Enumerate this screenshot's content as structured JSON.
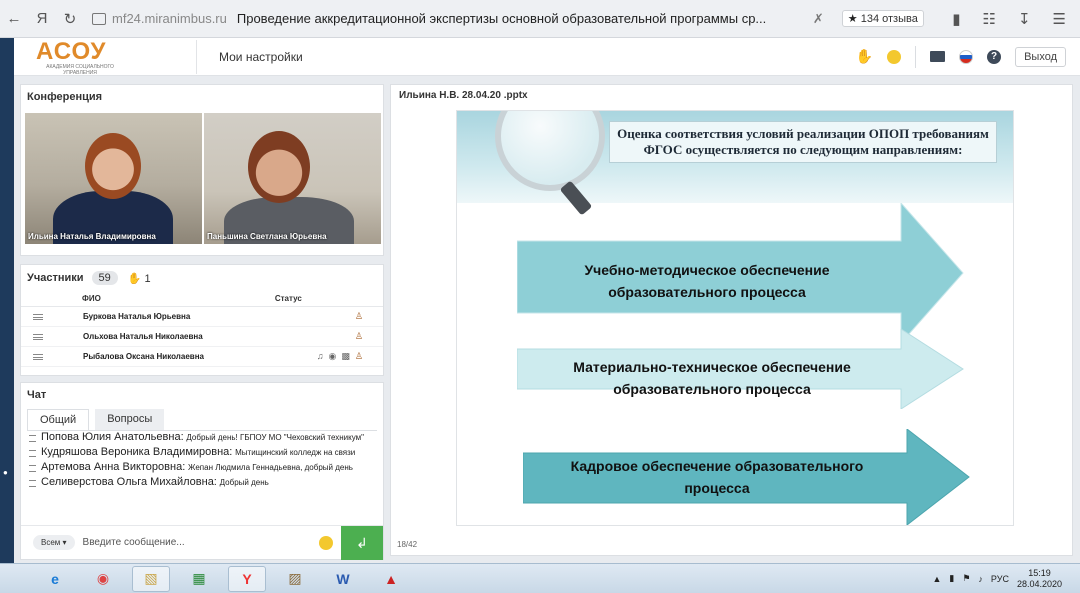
{
  "browser": {
    "url": "mf24.miranimbus.ru",
    "tab_title": "Проведение аккредитационной экспертизы основной образовательной программы ср...",
    "reviews": "134 отзыва",
    "ya_glyph": "Я"
  },
  "header": {
    "logo_text": "АСОУ",
    "logo_subtitle": "АКАДЕМИЯ СОЦИАЛЬНОГО УПРАВЛЕНИЯ",
    "settings_label": "Мои настройки",
    "logout_label": "Выход"
  },
  "conference": {
    "title": "Конференция",
    "videos": [
      {
        "name": "Ильина Наталья Владимировна"
      },
      {
        "name": "Паньшина Светлана Юрьевна"
      }
    ]
  },
  "participants": {
    "title": "Участники",
    "count": "59",
    "raised_hands": "1",
    "col_fio": "ФИО",
    "col_status": "Статус",
    "rows": [
      {
        "name": "Буркова Наталья Юрьевна"
      },
      {
        "name": "Ольхова Наталья Николаевна"
      },
      {
        "name": "Рыбалова  Оксана  Николаевна"
      }
    ]
  },
  "chat": {
    "title": "Чат",
    "tabs": [
      "Общий",
      "Вопросы"
    ],
    "messages": [
      {
        "author": "Попова Юлия Анатольевна:",
        "text": "Добрый день! ГБПОУ МО \"Чеховский техникум\""
      },
      {
        "author": "Кудряшова Вероника Владимировна:",
        "text": "Мытищинский колледж на связи"
      },
      {
        "author": "Артемова Анна Викторовна:",
        "text": "Жепан Людмила Геннадьевна, добрый день"
      },
      {
        "author": "Селиверстова Ольга Михайловна:",
        "text": "Добрый день"
      }
    ],
    "scope": "Всем",
    "input_placeholder": "Введите сообщение...",
    "send_glyph": "↲"
  },
  "presentation": {
    "file_title": "Ильина Н.В. 28.04.20 .pptx",
    "page": "18/42",
    "slide_heading": "Оценка соответствия условий реализации ОПОП требованиям  ФГОС осуществляется по следующим направлениям:",
    "arrows": [
      {
        "text": "Учебно-методическое обеспечение образовательного процесса",
        "color": "#8ecfd6"
      },
      {
        "text": "Материально-техническое  обеспечение образовательного процесса",
        "color": "#cdebee"
      },
      {
        "text": "Кадровое обеспечение образовательного процесса",
        "color": "#5fb6bf"
      }
    ]
  },
  "taskbar": {
    "lang": "РУС",
    "time": "15:19",
    "date": "28.04.2020"
  }
}
